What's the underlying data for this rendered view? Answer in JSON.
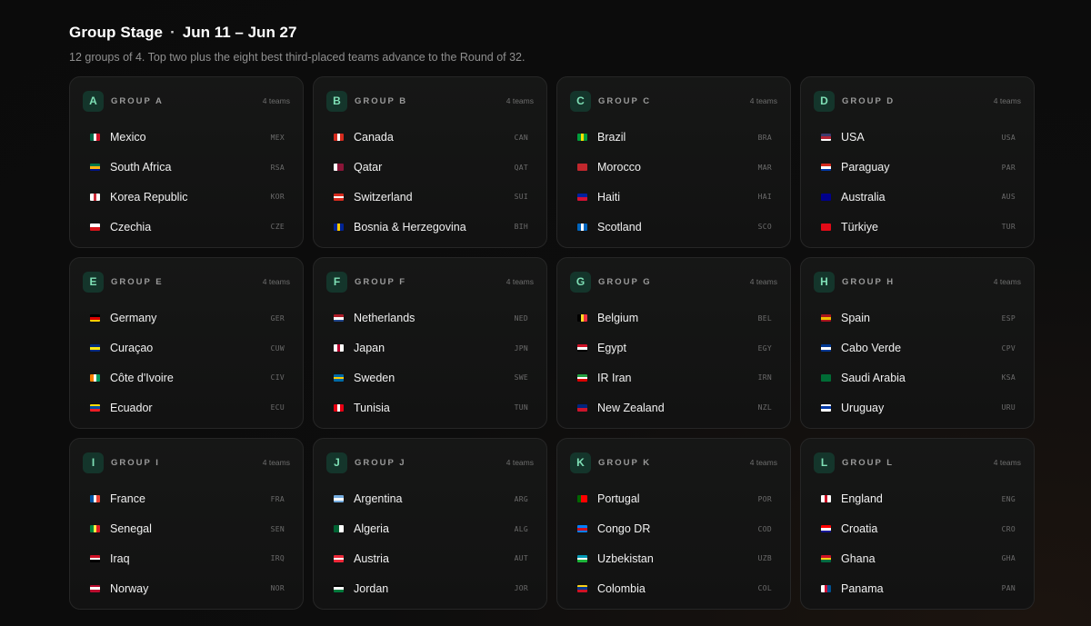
{
  "header": {
    "title": "Group Stage",
    "separator": "·",
    "dates": "Jun 11 – Jun 27",
    "subtitle": "12 groups of 4. Top two plus the eight best third-placed teams advance to the Round of 32."
  },
  "accent": "#7fe0b6",
  "groups": [
    {
      "letter": "A",
      "label": "GROUP A",
      "count": "4 teams",
      "teams": [
        {
          "name": "Mexico",
          "code": "MEX",
          "flag": [
            "#006847",
            "#ffffff",
            "#ce1126"
          ],
          "dir": "v"
        },
        {
          "name": "South Africa",
          "code": "RSA",
          "flag": [
            "#007749",
            "#ffb612",
            "#001489"
          ],
          "dir": "h"
        },
        {
          "name": "Korea Republic",
          "code": "KOR",
          "flag": [
            "#ffffff",
            "#cd2e3a",
            "#ffffff"
          ],
          "dir": "v"
        },
        {
          "name": "Czechia",
          "code": "CZE",
          "flag": [
            "#ffffff",
            "#d7141a"
          ],
          "dir": "h"
        }
      ]
    },
    {
      "letter": "B",
      "label": "GROUP B",
      "count": "4 teams",
      "teams": [
        {
          "name": "Canada",
          "code": "CAN",
          "flag": [
            "#d52b1e",
            "#ffffff",
            "#d52b1e"
          ],
          "dir": "v"
        },
        {
          "name": "Qatar",
          "code": "QAT",
          "flag": [
            "#ffffff",
            "#8a1538",
            "#8a1538"
          ],
          "dir": "v"
        },
        {
          "name": "Switzerland",
          "code": "SUI",
          "flag": [
            "#d52b1e",
            "#ffffff",
            "#d52b1e"
          ],
          "dir": "h"
        },
        {
          "name": "Bosnia & Herzegovina",
          "code": "BIH",
          "flag": [
            "#002395",
            "#fecb00",
            "#002395"
          ],
          "dir": "v"
        }
      ]
    },
    {
      "letter": "C",
      "label": "GROUP C",
      "count": "4 teams",
      "teams": [
        {
          "name": "Brazil",
          "code": "BRA",
          "flag": [
            "#009c3b",
            "#ffdf00",
            "#009c3b"
          ],
          "dir": "v"
        },
        {
          "name": "Morocco",
          "code": "MAR",
          "flag": [
            "#c1272d",
            "#c1272d"
          ],
          "dir": "h"
        },
        {
          "name": "Haiti",
          "code": "HAI",
          "flag": [
            "#00209f",
            "#d21034"
          ],
          "dir": "h"
        },
        {
          "name": "Scotland",
          "code": "SCO",
          "flag": [
            "#0065bd",
            "#ffffff",
            "#0065bd"
          ],
          "dir": "v"
        }
      ]
    },
    {
      "letter": "D",
      "label": "GROUP D",
      "count": "4 teams",
      "teams": [
        {
          "name": "USA",
          "code": "USA",
          "flag": [
            "#3c3b6e",
            "#b22234",
            "#ffffff"
          ],
          "dir": "h"
        },
        {
          "name": "Paraguay",
          "code": "PAR",
          "flag": [
            "#d52b1e",
            "#ffffff",
            "#0038a8"
          ],
          "dir": "h"
        },
        {
          "name": "Australia",
          "code": "AUS",
          "flag": [
            "#00008b",
            "#00008b"
          ],
          "dir": "h"
        },
        {
          "name": "Türkiye",
          "code": "TUR",
          "flag": [
            "#e30a17",
            "#e30a17"
          ],
          "dir": "h"
        }
      ]
    },
    {
      "letter": "E",
      "label": "GROUP E",
      "count": "4 teams",
      "teams": [
        {
          "name": "Germany",
          "code": "GER",
          "flag": [
            "#000000",
            "#dd0000",
            "#ffce00"
          ],
          "dir": "h"
        },
        {
          "name": "Curaçao",
          "code": "CUW",
          "flag": [
            "#002b7f",
            "#f9e814",
            "#002b7f"
          ],
          "dir": "h"
        },
        {
          "name": "Côte d'Ivoire",
          "code": "CIV",
          "flag": [
            "#f77f00",
            "#ffffff",
            "#009e60"
          ],
          "dir": "v"
        },
        {
          "name": "Ecuador",
          "code": "ECU",
          "flag": [
            "#ffdd00",
            "#034ea2",
            "#ed1c24"
          ],
          "dir": "h"
        }
      ]
    },
    {
      "letter": "F",
      "label": "GROUP F",
      "count": "4 teams",
      "teams": [
        {
          "name": "Netherlands",
          "code": "NED",
          "flag": [
            "#ae1c28",
            "#ffffff",
            "#21468b"
          ],
          "dir": "h"
        },
        {
          "name": "Japan",
          "code": "JPN",
          "flag": [
            "#ffffff",
            "#bc002d",
            "#ffffff"
          ],
          "dir": "v"
        },
        {
          "name": "Sweden",
          "code": "SWE",
          "flag": [
            "#006aa7",
            "#fecc00",
            "#006aa7"
          ],
          "dir": "h"
        },
        {
          "name": "Tunisia",
          "code": "TUN",
          "flag": [
            "#e70013",
            "#ffffff",
            "#e70013"
          ],
          "dir": "v"
        }
      ]
    },
    {
      "letter": "G",
      "label": "GROUP G",
      "count": "4 teams",
      "teams": [
        {
          "name": "Belgium",
          "code": "BEL",
          "flag": [
            "#000000",
            "#fdda24",
            "#ef3340"
          ],
          "dir": "v"
        },
        {
          "name": "Egypt",
          "code": "EGY",
          "flag": [
            "#ce1126",
            "#ffffff",
            "#000000"
          ],
          "dir": "h"
        },
        {
          "name": "IR Iran",
          "code": "IRN",
          "flag": [
            "#239f40",
            "#ffffff",
            "#da0000"
          ],
          "dir": "h"
        },
        {
          "name": "New Zealand",
          "code": "NZL",
          "flag": [
            "#00247d",
            "#cc142b"
          ],
          "dir": "h"
        }
      ]
    },
    {
      "letter": "H",
      "label": "GROUP H",
      "count": "4 teams",
      "teams": [
        {
          "name": "Spain",
          "code": "ESP",
          "flag": [
            "#aa151b",
            "#f1bf00",
            "#aa151b"
          ],
          "dir": "h"
        },
        {
          "name": "Cabo Verde",
          "code": "CPV",
          "flag": [
            "#003893",
            "#ffffff",
            "#003893"
          ],
          "dir": "h"
        },
        {
          "name": "Saudi Arabia",
          "code": "KSA",
          "flag": [
            "#006c35",
            "#006c35"
          ],
          "dir": "h"
        },
        {
          "name": "Uruguay",
          "code": "URU",
          "flag": [
            "#ffffff",
            "#0038a8",
            "#ffffff"
          ],
          "dir": "h"
        }
      ]
    },
    {
      "letter": "I",
      "label": "GROUP I",
      "count": "4 teams",
      "teams": [
        {
          "name": "France",
          "code": "FRA",
          "flag": [
            "#0055a4",
            "#ffffff",
            "#ef4135"
          ],
          "dir": "v"
        },
        {
          "name": "Senegal",
          "code": "SEN",
          "flag": [
            "#00853f",
            "#fdef42",
            "#e31b23"
          ],
          "dir": "v"
        },
        {
          "name": "Iraq",
          "code": "IRQ",
          "flag": [
            "#ce1126",
            "#ffffff",
            "#000000"
          ],
          "dir": "h"
        },
        {
          "name": "Norway",
          "code": "NOR",
          "flag": [
            "#ba0c2f",
            "#ffffff",
            "#ba0c2f"
          ],
          "dir": "h"
        }
      ]
    },
    {
      "letter": "J",
      "label": "GROUP J",
      "count": "4 teams",
      "teams": [
        {
          "name": "Argentina",
          "code": "ARG",
          "flag": [
            "#74acdf",
            "#ffffff",
            "#74acdf"
          ],
          "dir": "h"
        },
        {
          "name": "Algeria",
          "code": "ALG",
          "flag": [
            "#006233",
            "#ffffff"
          ],
          "dir": "v"
        },
        {
          "name": "Austria",
          "code": "AUT",
          "flag": [
            "#ed2939",
            "#ffffff",
            "#ed2939"
          ],
          "dir": "h"
        },
        {
          "name": "Jordan",
          "code": "JOR",
          "flag": [
            "#000000",
            "#ffffff",
            "#007a3d"
          ],
          "dir": "h"
        }
      ]
    },
    {
      "letter": "K",
      "label": "GROUP K",
      "count": "4 teams",
      "teams": [
        {
          "name": "Portugal",
          "code": "POR",
          "flag": [
            "#006600",
            "#ff0000",
            "#ff0000"
          ],
          "dir": "v"
        },
        {
          "name": "Congo DR",
          "code": "COD",
          "flag": [
            "#007fff",
            "#ce1021",
            "#007fff"
          ],
          "dir": "h"
        },
        {
          "name": "Uzbekistan",
          "code": "UZB",
          "flag": [
            "#0099b5",
            "#ffffff",
            "#1eb53a"
          ],
          "dir": "h"
        },
        {
          "name": "Colombia",
          "code": "COL",
          "flag": [
            "#fcd116",
            "#003893",
            "#ce1126"
          ],
          "dir": "h"
        }
      ]
    },
    {
      "letter": "L",
      "label": "GROUP L",
      "count": "4 teams",
      "teams": [
        {
          "name": "England",
          "code": "ENG",
          "flag": [
            "#ffffff",
            "#ce1124",
            "#ffffff"
          ],
          "dir": "v"
        },
        {
          "name": "Croatia",
          "code": "CRO",
          "flag": [
            "#ff0000",
            "#ffffff",
            "#171796"
          ],
          "dir": "h"
        },
        {
          "name": "Ghana",
          "code": "GHA",
          "flag": [
            "#ce1126",
            "#fcd116",
            "#006b3f"
          ],
          "dir": "h"
        },
        {
          "name": "Panama",
          "code": "PAN",
          "flag": [
            "#ffffff",
            "#d21034",
            "#005293"
          ],
          "dir": "v"
        }
      ]
    }
  ]
}
